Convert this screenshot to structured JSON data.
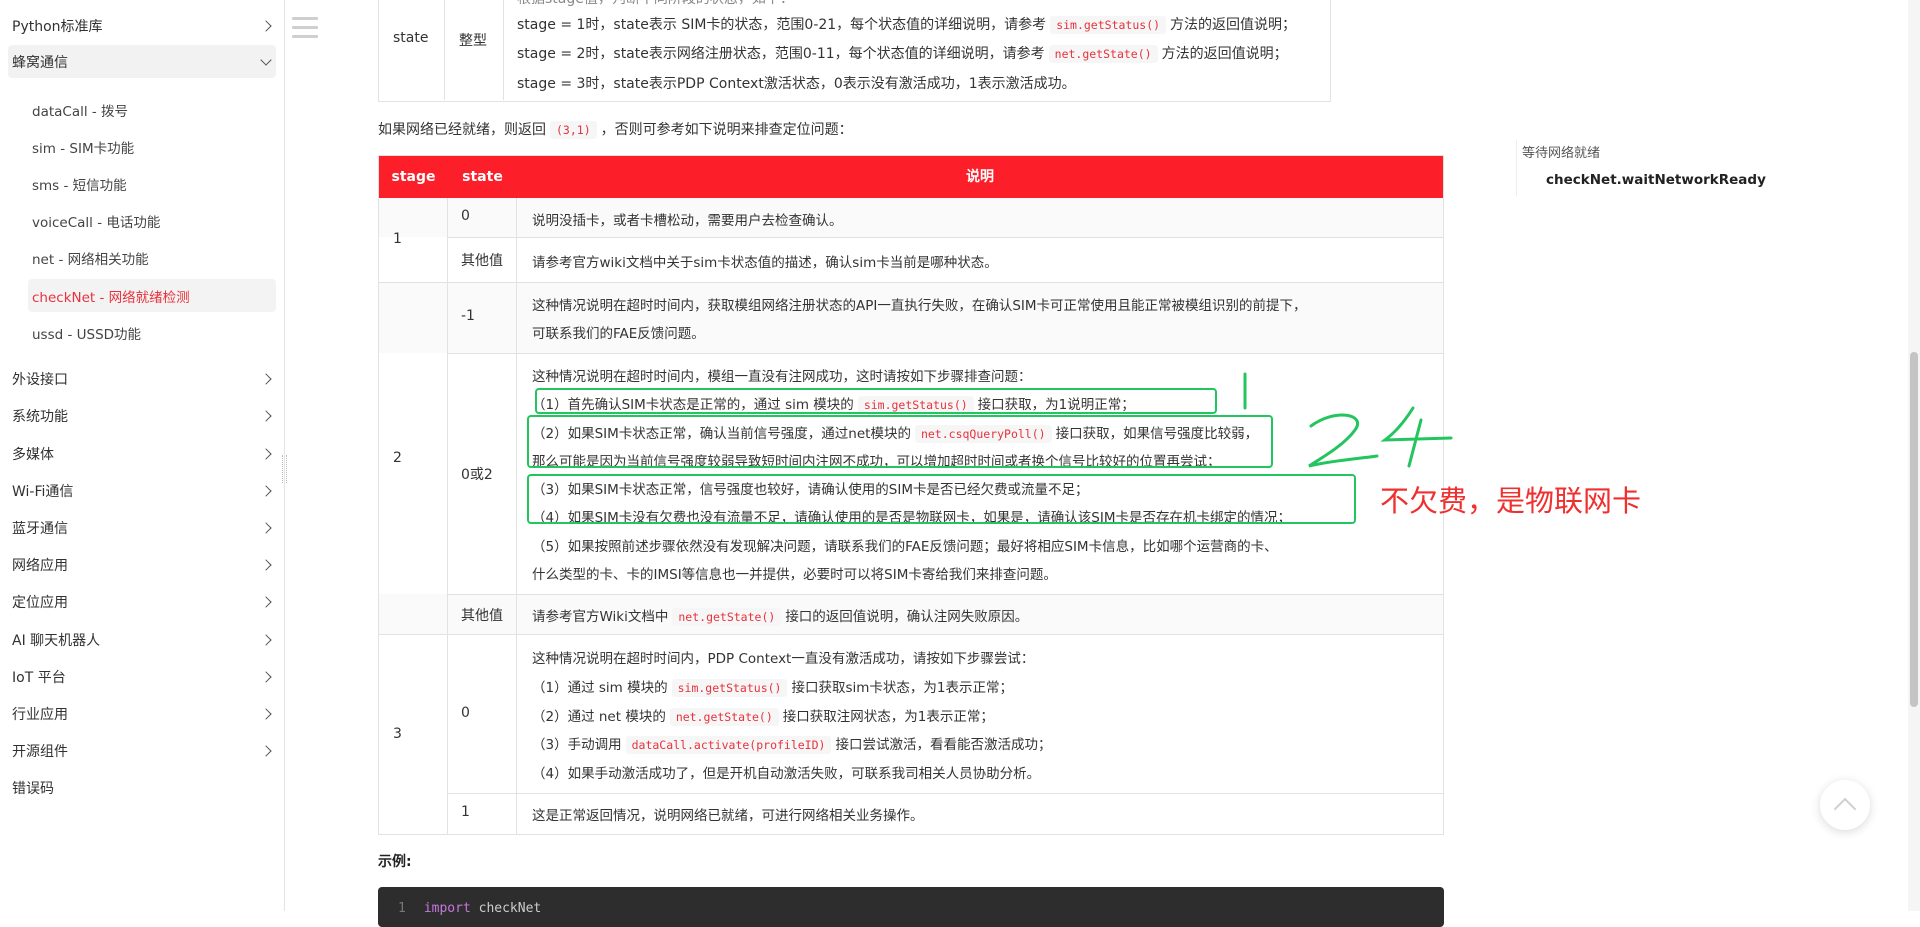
{
  "sidebar": {
    "top_item": "Python标准库",
    "open_section": "蜂窝通信",
    "sub_items": [
      {
        "label": "dataCall - 拨号"
      },
      {
        "label": "sim - SIM卡功能"
      },
      {
        "label": "sms - 短信功能"
      },
      {
        "label": "voiceCall - 电话功能"
      },
      {
        "label": "net - 网络相关功能"
      },
      {
        "label": "checkNet - 网络就绪检测"
      },
      {
        "label": "ussd - USSD功能"
      }
    ],
    "sections": [
      {
        "label": "外设接口"
      },
      {
        "label": "系统功能"
      },
      {
        "label": "多媒体"
      },
      {
        "label": "Wi-Fi通信"
      },
      {
        "label": "蓝牙通信"
      },
      {
        "label": "网络应用"
      },
      {
        "label": "定位应用"
      },
      {
        "label": "AI 聊天机器人"
      },
      {
        "label": "IoT 平台"
      },
      {
        "label": "行业应用"
      },
      {
        "label": "开源组件"
      },
      {
        "label": "错误码"
      }
    ]
  },
  "top_table": {
    "name": "state",
    "type": "整型",
    "lines": {
      "l0": "根据stage值，判断不同阶段的状态，如下：",
      "l1a": "stage = 1时，state表示 SIM卡的状态，范围0-21，每个状态值的详细说明，请参考",
      "l1code": "sim.getStatus()",
      "l1b": "方法的返回值说明；",
      "l2a": "stage = 2时，state表示网络注册状态，范围0-11，每个状态值的详细说明，请参考",
      "l2code": "net.getState()",
      "l2b": "方法的返回值说明；",
      "l3": "stage = 3时，state表示PDP Context激活状态，0表示没有激活成功，1表示激活成功。"
    }
  },
  "intro": {
    "a": "如果网络已经就绪，则返回",
    "code": "(3,1)",
    "b": "，否则可参考如下说明来排查定位问题："
  },
  "table": {
    "headers": [
      "stage",
      "state",
      "说明"
    ],
    "r1": {
      "stage": "1",
      "s0": "0",
      "d0": "说明没插卡，或者卡槽松动，需要用户去检查确认。",
      "s1": "其他值",
      "d1": "请参考官方wiki文档中关于sim卡状态值的描述，确认sim卡当前是哪种状态。"
    },
    "r2": {
      "stage": "2",
      "s0": "-1",
      "d0a": "这种情况说明在超时时间内，获取模组网络注册状态的API一直执行失败，在确认SIM卡可正常使用且能正常被模组识别的前提下，",
      "d0b": "可联系我们的FAE反馈问题。",
      "s1": "0或2",
      "d1_0": "这种情况说明在超时时间内，模组一直没有注网成功，这时请按如下步骤排查问题：",
      "d1_1a": "（1）首先确认SIM卡状态是正常的，通过 sim 模块的",
      "d1_1code": "sim.getStatus()",
      "d1_1b": "接口获取，为1说明正常；",
      "d1_2a": "（2）如果SIM卡状态正常，确认当前信号强度，通过net模块的",
      "d1_2code": "net.csqQueryPoll()",
      "d1_2b": "接口获取，如果信号强度比较弱，",
      "d1_3": "那么可能是因为当前信号强度较弱导致短时间内注网不成功，可以增加超时时间或者换个信号比较好的位置再尝试；",
      "d1_4": "（3）如果SIM卡状态正常，信号强度也较好，请确认使用的SIM卡是否已经欠费或流量不足；",
      "d1_5": "（4）如果SIM卡没有欠费也没有流量不足，请确认使用的是否是物联网卡，如果是，请确认该SIM卡是否存在机卡绑定的情况；",
      "d1_6": "（5）如果按照前述步骤依然没有发现解决问题，请联系我们的FAE反馈问题；最好将相应SIM卡信息，比如哪个运营商的卡、",
      "d1_7": "什么类型的卡、卡的IMSI等信息也一并提供，必要时可以将SIM卡寄给我们来排查问题。",
      "s2": "其他值",
      "d2a": "请参考官方Wiki文档中",
      "d2code": "net.getState()",
      "d2b": "接口的返回值说明，确认注网失败原因。"
    },
    "r3": {
      "stage": "3",
      "s0": "0",
      "d0_0": "这种情况说明在超时时间内，PDP Context一直没有激活成功，请按如下步骤尝试：",
      "d0_1a": "（1）通过 sim 模块的",
      "d0_1code": "sim.getStatus()",
      "d0_1b": "接口获取sim卡状态，为1表示正常；",
      "d0_2a": "（2）通过 net 模块的",
      "d0_2code": "net.getState()",
      "d0_2b": "接口获取注网状态，为1表示正常；",
      "d0_3a": "（3）手动调用",
      "d0_3code": "dataCall.activate(profileID)",
      "d0_3b": "接口尝试激活，看看能否激活成功；",
      "d0_4": "（4）如果手动激活成功了，但是开机自动激活失败，可联系我司相关人员协助分析。",
      "s1": "1",
      "d1": "这是正常返回情况，说明网络已就绪，可进行网络相关业务操作。"
    }
  },
  "annotations": {
    "mark_1": "1",
    "mark_24": "24",
    "note": "不欠费，是物联网卡",
    "color_green": "#22c55e",
    "color_red": "#f0302f"
  },
  "example": {
    "label": "示例:",
    "line_no": "1",
    "keyword": "import",
    "module": "checkNet"
  },
  "toc": {
    "title": "等待网络就绪",
    "item": "checkNet.waitNetworkReady"
  },
  "colors": {
    "header_red": "#fc1f2a",
    "active_red": "#e8323c"
  }
}
